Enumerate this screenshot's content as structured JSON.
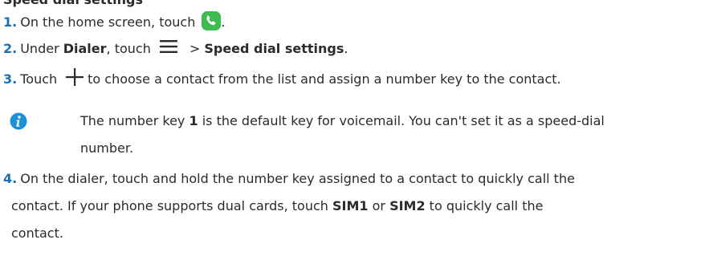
{
  "top_clipped_heading": "Speed dial settings",
  "steps": {
    "s1": {
      "num": "1.",
      "text": "On the home screen, touch",
      "trail": "."
    },
    "s2": {
      "num": "2.",
      "pre": "Under ",
      "dialer": "Dialer",
      "mid": ", touch",
      "sep": "> ",
      "target": "Speed dial settings",
      "trail": "."
    },
    "s3": {
      "num": "3.",
      "pre": "Touch",
      "post": "to choose a contact from the list and assign a number key to the contact."
    },
    "note": {
      "pre": "The number key ",
      "key": "1",
      "post": " is the default key for voicemail. You can't set it as a speed-dial",
      "line2": "number."
    },
    "s4": {
      "num": "4.",
      "line1": "On the dialer, touch and hold the number key assigned to a contact to quickly call the",
      "line2_pre": "contact. If your phone supports dual cards, touch ",
      "sim1": "SIM1",
      "or": " or ",
      "sim2": "SIM2",
      "line2_post": " to quickly call the",
      "line3": "contact."
    }
  },
  "colors": {
    "accent_blue": "#1a6fb5",
    "phone_green": "#3dbb4e",
    "info_blue": "#1e90d6"
  },
  "icons": {
    "phone": "phone-app-icon",
    "menu": "menu-icon",
    "plus": "plus-icon",
    "info": "info-icon"
  }
}
